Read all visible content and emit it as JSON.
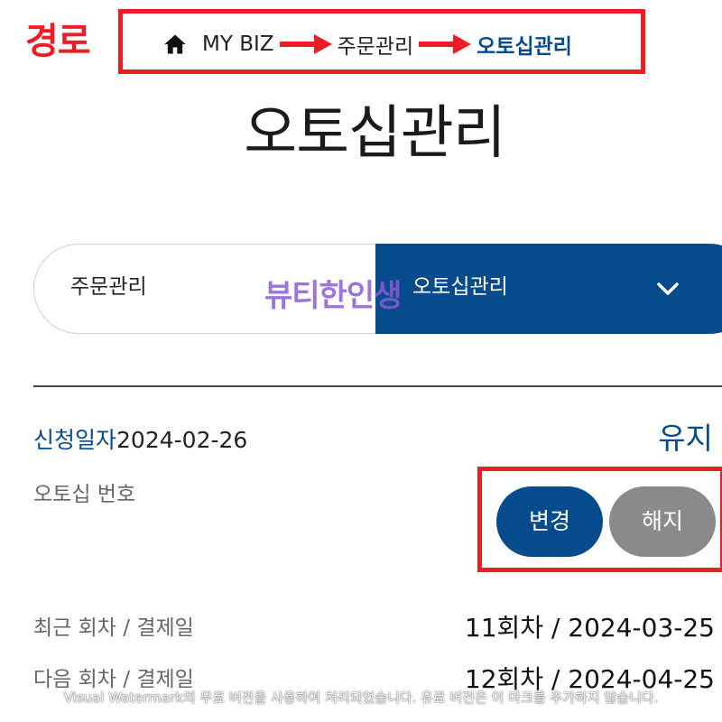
{
  "annotation": {
    "label": "경로",
    "color": "#ee1c24"
  },
  "breadcrumb": {
    "home_icon": "home-icon",
    "items": [
      "MY BIZ",
      "주문관리",
      "오토십관리"
    ]
  },
  "page": {
    "title": "오토십관리"
  },
  "selector": {
    "left_label": "주문관리",
    "right_label": "오토십관리",
    "chevron_icon": "chevron-down-icon",
    "accent_color": "#064b8c"
  },
  "overlay_watermark": "뷰티한인생",
  "autoship": {
    "apply_label": "신청일자",
    "apply_date": "2024-02-26",
    "status": "유지",
    "number_label": "오토십 번호",
    "change_button": "변경",
    "cancel_button": "해지",
    "rows": [
      {
        "label": "최근 회차 / 결제일",
        "value": "11회차 / 2024-03-25"
      },
      {
        "label": "다음 회차 / 결제일",
        "value": "12회차 / 2024-04-25"
      }
    ]
  },
  "footer_watermark": "Visual Watermark의 무료 버전을 사용하여 처리되었습니다. 유료 버전은 이 마크를 추가하지 않습니다."
}
